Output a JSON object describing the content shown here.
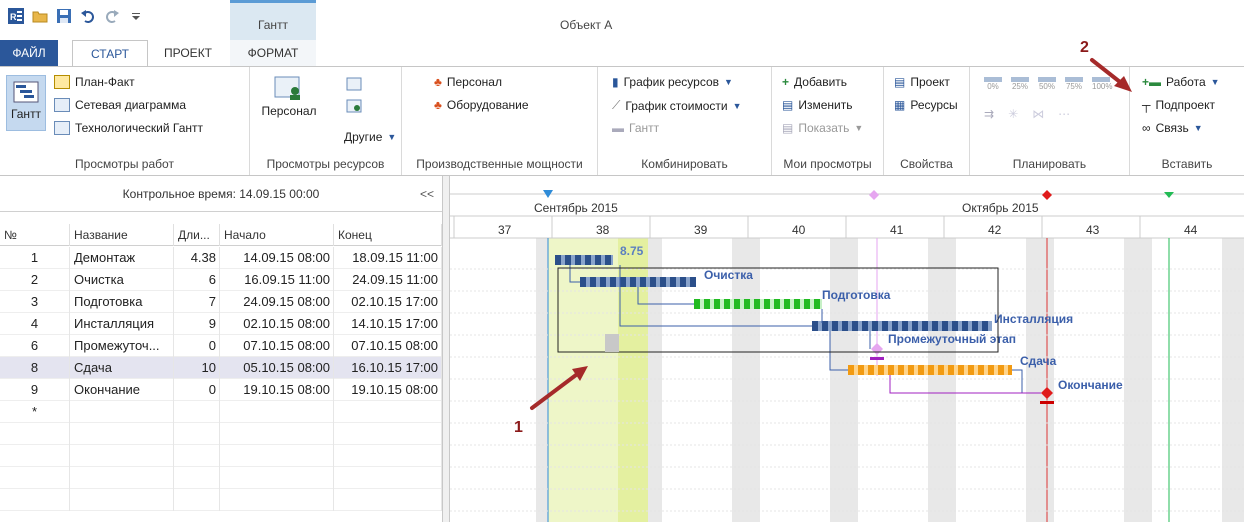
{
  "app": {
    "window_title": "Объект А",
    "context_tab_title": "Гантт"
  },
  "tabs": {
    "file": "ФАЙЛ",
    "start": "СТАРТ",
    "project": "ПРОЕКТ",
    "format": "ФОРМАТ"
  },
  "ribbon": {
    "views_work": {
      "gantt": "Гантт",
      "plan_fact": "План-Факт",
      "network": "Сетевая диаграмма",
      "tech_gantt": "Технологический Гантт",
      "label": "Просмотры работ"
    },
    "views_resources": {
      "personnel": "Персонал",
      "others": "Другие",
      "label": "Просмотры ресурсов"
    },
    "capacity": {
      "personnel": "Персонал",
      "equipment": "Оборудование",
      "label": "Производственные мощности"
    },
    "combine": {
      "resource_chart": "График ресурсов",
      "cost_chart": "График стоимости",
      "gantt": "Гантт",
      "label": "Комбинировать"
    },
    "my_views": {
      "add": "Добавить",
      "edit": "Изменить",
      "show": "Показать",
      "label": "Мои просмотры"
    },
    "properties": {
      "project": "Проект",
      "resources": "Ресурсы",
      "label": "Свойства"
    },
    "plan": {
      "pct": [
        "0%",
        "25%",
        "50%",
        "75%",
        "100%"
      ],
      "label": "Планировать"
    },
    "insert": {
      "work": "Работа",
      "subproject": "Подпроект",
      "link": "Связь",
      "label": "Вставить"
    }
  },
  "table": {
    "control_time": "Контрольное время: 14.09.15 00:00",
    "collapse": "<<",
    "headers": [
      "№",
      "Название",
      "Дли...",
      "Начало",
      "Конец"
    ],
    "rows": [
      {
        "num": "1",
        "name": "Демонтаж",
        "dur": "4.38",
        "start": "14.09.15 08:00",
        "end": "18.09.15 11:00"
      },
      {
        "num": "2",
        "name": "Очистка",
        "dur": "6",
        "start": "16.09.15 11:00",
        "end": "24.09.15 11:00"
      },
      {
        "num": "3",
        "name": "Подготовка",
        "dur": "7",
        "start": "24.09.15 08:00",
        "end": "02.10.15 17:00"
      },
      {
        "num": "4",
        "name": "Инсталляция",
        "dur": "9",
        "start": "02.10.15 08:00",
        "end": "14.10.15 17:00"
      },
      {
        "num": "6",
        "name": "Промежуточ...",
        "dur": "0",
        "start": "07.10.15 08:00",
        "end": "07.10.15 08:00"
      },
      {
        "num": "8",
        "name": "Сдача",
        "dur": "10",
        "start": "05.10.15 08:00",
        "end": "16.10.15 17:00"
      },
      {
        "num": "9",
        "name": "Окончание",
        "dur": "0",
        "start": "19.10.15 08:00",
        "end": "19.10.15 08:00"
      }
    ],
    "new_row_marker": "*"
  },
  "gantt": {
    "months": [
      "Сентябрь 2015",
      "Октябрь 2015"
    ],
    "weeks": [
      "37",
      "38",
      "39",
      "40",
      "41",
      "42",
      "43",
      "44"
    ],
    "bar_labels": {
      "t1": "8.75",
      "t2": "Очистка",
      "t3": "Подготовка",
      "t4": "Инсталляция",
      "t6": "Промежуточный этап",
      "t8": "Сдача",
      "t9": "Окончание"
    },
    "annotations": [
      "1",
      "2"
    ]
  },
  "colors": {
    "file_tab": "#2b579a",
    "task_blue": "#5b7fc0",
    "task_green": "#22bb22",
    "task_orange": "#f29a11",
    "milestone_red": "#e01b1b",
    "milestone_pink": "#e6a6f0",
    "arrow_red": "#a52a2a",
    "highlight_green": "#eef6c8"
  }
}
